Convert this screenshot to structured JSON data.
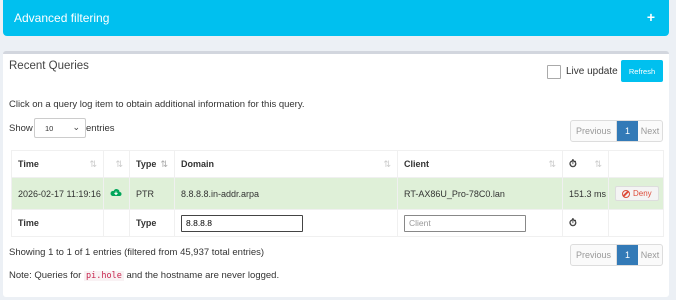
{
  "advanced": {
    "title": "Advanced filtering",
    "expand_icon": "+"
  },
  "box": {
    "title": "Recent Queries",
    "live_update": "Live update",
    "refresh": "Refresh"
  },
  "info": "Click on a query log item to obtain additional information for this query.",
  "length": {
    "show": "Show",
    "value": "10",
    "entries": "entries"
  },
  "pager": {
    "prev": "Previous",
    "current": "1",
    "next": "Next"
  },
  "columns": {
    "time": "Time",
    "type": "Type",
    "domain": "Domain",
    "client": "Client"
  },
  "row": {
    "time": "2026-02-17 11:19:16",
    "type": "PTR",
    "domain": "8.8.8.8.in-addr.arpa",
    "client": "RT-AX86U_Pro-78C0.lan",
    "reply_time": "151.3 ms",
    "deny": "Deny",
    "status_color": "#00a65a"
  },
  "filter": {
    "time": "Time",
    "type": "Type",
    "domain_value": "8.8.8.8",
    "client_placeholder": "Client"
  },
  "status": "Showing 1 to 1 of 1 entries (filtered from 45,937 total entries)",
  "note": {
    "prefix": "Note: Queries for ",
    "code": "pi.hole",
    "suffix": " and the hostname are never logged."
  },
  "colors": {
    "accent": "#00c0ef",
    "pager_active": "#337ab7",
    "row_ok": "#dff0d8",
    "deny": "#dd4b39"
  }
}
